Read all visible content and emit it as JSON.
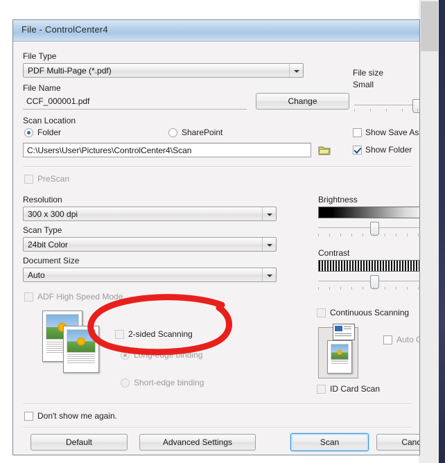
{
  "window": {
    "title": "File - ControlCenter4"
  },
  "left": {
    "file_type_label": "File Type",
    "file_type_value": "PDF Multi-Page (*.pdf)",
    "file_name_label": "File Name",
    "file_name_value": "CCF_000001.pdf",
    "scan_location_label": "Scan Location",
    "folder_radio_label": "Folder",
    "sharepoint_radio_label": "SharePoint",
    "path_value": "C:\\Users\\User\\Pictures\\ControlCenter4\\Scan",
    "prescan_label": "PreScan",
    "resolution_label": "Resolution",
    "resolution_value": "300 x 300 dpi",
    "scan_type_label": "Scan Type",
    "scan_type_value": "24bit Color",
    "document_size_label": "Document Size",
    "document_size_value": "Auto",
    "adf_label": "ADF High Speed Mode",
    "two_sided_label": "2-sided Scanning",
    "long_edge_label": "Long-edge binding",
    "short_edge_label": "Short-edge binding",
    "dont_show_label": "Don't show me again."
  },
  "right": {
    "file_size_label": "File size",
    "file_size_value": "Small",
    "show_save_as_label": "Show Save As",
    "show_folder_label": "Show Folder",
    "brightness_label": "Brightness",
    "contrast_label": "Contrast",
    "continuous_label": "Continuous Scanning",
    "auto_crop_label": "Auto Crop",
    "id_card_label": "ID Card Scan"
  },
  "buttons": {
    "default": "Default",
    "advanced_settings": "Advanced Settings",
    "scan": "Scan",
    "cancel": "Cancel",
    "change": "Change"
  },
  "icons": {
    "folder_browse": "folder-browse-icon",
    "dropdown_arrow": "chevron-down-icon",
    "annotation": "red-ellipse-annotation"
  },
  "colors": {
    "annotation_red": "#e8201c",
    "titlebar_blue": "#a9c8e6",
    "focus_blue": "#3c93d6",
    "dialog_bg": "#f5f2f4"
  }
}
